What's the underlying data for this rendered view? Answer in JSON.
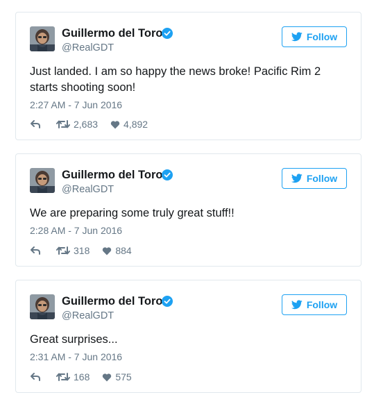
{
  "colors": {
    "accent": "#1da1f2",
    "secondary_text": "#657786",
    "border": "#e1e8ed"
  },
  "icons": {
    "avatar": "user-avatar",
    "verified": "verified-badge-icon",
    "follow": "twitter-bird-icon",
    "reply": "reply-icon",
    "retweet": "retweet-icon",
    "like": "heart-icon"
  },
  "tweets": [
    {
      "name": "Guillermo del Toro",
      "handle": "@RealGDT",
      "follow_label": "Follow",
      "text": "Just landed. I am so happy the news broke! Pacific Rim 2 starts shooting soon!",
      "timestamp": "2:27 AM - 7 Jun 2016",
      "retweets": "2,683",
      "likes": "4,892"
    },
    {
      "name": "Guillermo del Toro",
      "handle": "@RealGDT",
      "follow_label": "Follow",
      "text": "We are preparing some truly great stuff!!",
      "timestamp": "2:28 AM - 7 Jun 2016",
      "retweets": "318",
      "likes": "884"
    },
    {
      "name": "Guillermo del Toro",
      "handle": "@RealGDT",
      "follow_label": "Follow",
      "text": "Great surprises...",
      "timestamp": "2:31 AM - 7 Jun 2016",
      "retweets": "168",
      "likes": "575"
    }
  ]
}
